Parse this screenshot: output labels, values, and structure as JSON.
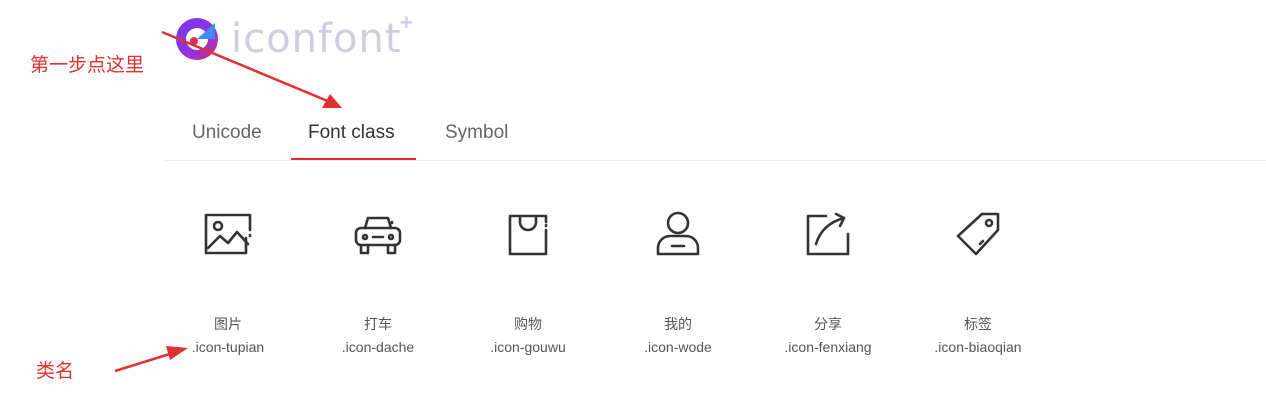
{
  "logo": {
    "text": "iconfont",
    "plus": "+"
  },
  "tabs": [
    {
      "label": "Unicode",
      "active": false
    },
    {
      "label": "Font class",
      "active": true
    },
    {
      "label": "Symbol",
      "active": false
    }
  ],
  "icons": [
    {
      "name": "图片",
      "class": ".icon-tupian",
      "icon": "picture-icon"
    },
    {
      "name": "打车",
      "class": ".icon-dache",
      "icon": "car-icon"
    },
    {
      "name": "购物",
      "class": ".icon-gouwu",
      "icon": "shopping-bag-icon"
    },
    {
      "name": "我的",
      "class": ".icon-wode",
      "icon": "user-icon"
    },
    {
      "name": "分享",
      "class": ".icon-fenxiang",
      "icon": "share-icon"
    },
    {
      "name": "标签",
      "class": ".icon-biaoqian",
      "icon": "tag-icon"
    }
  ],
  "annotations": {
    "step1": "第一步点这里",
    "classname": "类名"
  },
  "colors": {
    "accent": "#e02b2b",
    "annotation": "#e03030",
    "logo_text": "#cfcdde",
    "icon_stroke": "#333333"
  }
}
